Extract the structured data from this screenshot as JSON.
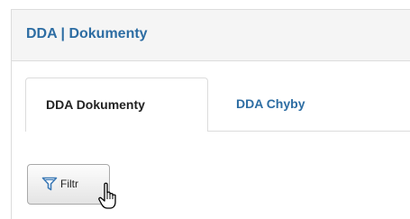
{
  "panel": {
    "title": "DDA | Dokumenty"
  },
  "tabs": [
    {
      "label": "DDA Dokumenty",
      "active": true
    },
    {
      "label": "DDA Chyby",
      "active": false
    }
  ],
  "toolbar": {
    "filter_label": "Filtr",
    "filter_icon": "filter-icon"
  },
  "cursor": {
    "icon": "hand-pointer-icon"
  },
  "colors": {
    "title": "#2d6da3",
    "link_tab": "#2d6da3",
    "active_tab_text": "#222222",
    "border": "#dcdcdc",
    "header_bg": "#f5f5f5",
    "filter_icon": "#3a78b5"
  }
}
